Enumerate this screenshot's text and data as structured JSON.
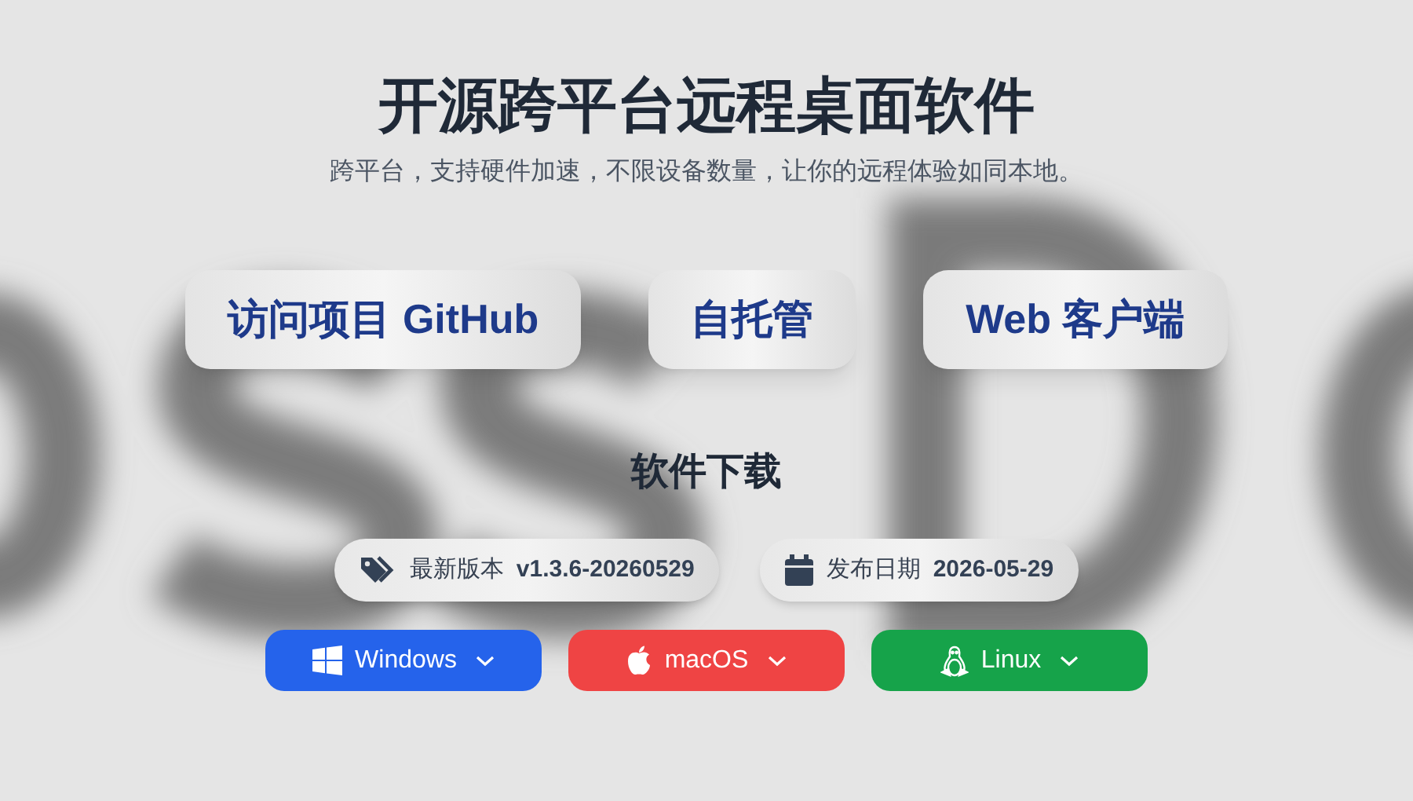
{
  "title": "开源跨平台远程桌面软件",
  "subtitle": "跨平台，支持硬件加速，不限设备数量，让你的远程体验如同本地。",
  "links": [
    {
      "label": "访问项目 GitHub"
    },
    {
      "label": "自托管"
    },
    {
      "label": "Web 客户端"
    }
  ],
  "download": {
    "heading": "软件下载",
    "info": [
      {
        "kind": "tags",
        "label": "最新版本",
        "value": "v1.3.6-20260529"
      },
      {
        "kind": "calendar",
        "label": "发布日期",
        "value": "2026-05-29"
      }
    ],
    "platforms": [
      {
        "kind": "windows",
        "label": "Windows",
        "color": "#2563eb"
      },
      {
        "kind": "apple",
        "label": "macOS",
        "color": "#ef4444"
      },
      {
        "kind": "linux",
        "label": "Linux",
        "color": "#16a34a"
      }
    ]
  }
}
